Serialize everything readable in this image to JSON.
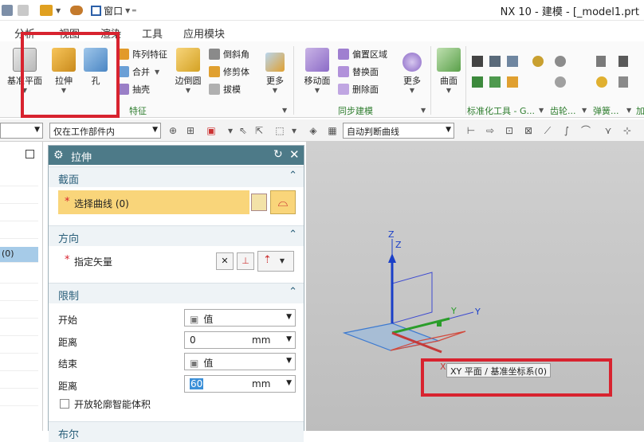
{
  "window": {
    "title": "NX 10 - 建模 - [_model1.prt"
  },
  "quick_access": {
    "window_menu": "窗口"
  },
  "menu": [
    "分析",
    "视图",
    "渲染",
    "工具",
    "应用模块"
  ],
  "ribbon": {
    "feature_group": {
      "datum_plane": "基准平面",
      "extrude": "拉伸",
      "hole": "孔",
      "pattern_feature": "阵列特征",
      "unite": "合并",
      "shell": "抽壳",
      "edge_blend": "边倒圆",
      "chamfer": "倒斜角",
      "trim_body": "修剪体",
      "draft": "拔模",
      "more": "更多",
      "label": "特征"
    },
    "sync_group": {
      "move_face": "移动面",
      "offset_region": "偏置区域",
      "replace_face": "替换面",
      "delete_face": "删除面",
      "more": "更多",
      "label": "同步建模"
    },
    "surface_group": {
      "surface": "曲面"
    },
    "std_tools": {
      "label": "标准化工具 - G..."
    },
    "gear": {
      "label": "齿轮..."
    },
    "spring": {
      "label": "弹簧..."
    },
    "extra": {
      "label": "加"
    }
  },
  "toolbar2": {
    "filter_left": "",
    "scope": "仅在工作部件内",
    "curve_rule": "自动判断曲线"
  },
  "nav": {
    "selected_item": "(0)"
  },
  "dialog": {
    "title": "拉伸",
    "section": {
      "title": "截面",
      "select_curve": "选择曲线 (0)"
    },
    "direction": {
      "title": "方向",
      "specify_vector": "指定矢量"
    },
    "limits": {
      "title": "限制",
      "start_label": "开始",
      "start_value": "值",
      "start_dist_label": "距离",
      "start_dist": "0",
      "start_unit": "mm",
      "end_label": "结束",
      "end_value": "值",
      "end_dist_label": "距离",
      "end_dist": "60",
      "end_unit": "mm",
      "open_profile": "开放轮廓智能体积"
    },
    "next_section": "布尔"
  },
  "viewport": {
    "tooltip": "XY 平面 / 基准坐标系(0)",
    "axis_z_top": "Z",
    "axis_z_mid": "Z",
    "axis_y_near": "Y",
    "axis_y_far": "Y",
    "axis_x": "X"
  },
  "colors": {
    "ribbon_group_label": "#2f7d2f",
    "dialog_header": "#4d7a88",
    "highlight_red": "#d8232f",
    "select_row": "#f9d57a"
  }
}
